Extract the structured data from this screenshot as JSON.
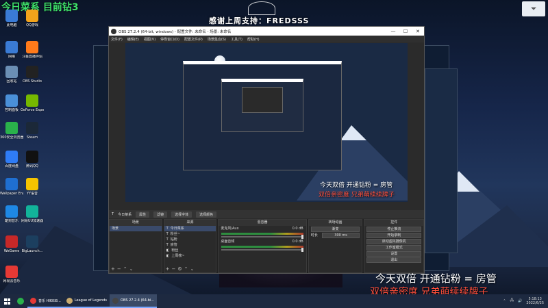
{
  "overlay_title": "今日菜系  目前钻3",
  "banner": "感谢上周支持：FREDSSS",
  "badge": "",
  "desktop_icons": [
    {
      "label": "此电脑",
      "icon": "computer-icon",
      "color": "#3a7bd5"
    },
    {
      "label": "QQ游戏",
      "icon": "qq-game-icon",
      "color": "#f2a31b"
    },
    {
      "label": "网络",
      "icon": "network-icon",
      "color": "#3a7bd5"
    },
    {
      "label": "斗鱼直播伴侣",
      "icon": "douyu-icon",
      "color": "#ff7a1a"
    },
    {
      "label": "回收站",
      "icon": "recycle-bin-icon",
      "color": "#6b8fb5"
    },
    {
      "label": "OBS Studio",
      "icon": "obs-icon",
      "color": "#222222"
    },
    {
      "label": "控制面板",
      "icon": "control-panel-icon",
      "color": "#4a90d9"
    },
    {
      "label": "GeForce Experience",
      "icon": "geforce-icon",
      "color": "#76b900"
    },
    {
      "label": "360安全浏览器",
      "icon": "360-browser-icon",
      "color": "#2ab24b"
    },
    {
      "label": "Steam",
      "icon": "steam-icon",
      "color": "#1b2838"
    },
    {
      "label": "百度网盘",
      "icon": "baidu-netdisk-icon",
      "color": "#2f7cf6"
    },
    {
      "label": "腾讯QQ",
      "icon": "qq-icon",
      "color": "#111111"
    },
    {
      "label": "Wallpaper Engine: ...",
      "icon": "wallpaper-engine-icon",
      "color": "#1f6fd1"
    },
    {
      "label": "YY语音",
      "icon": "yy-icon",
      "color": "#f5c400"
    },
    {
      "label": "酷狗音乐",
      "icon": "kugou-icon",
      "color": "#1e88e5"
    },
    {
      "label": "网易UU加速器",
      "icon": "uu-icon",
      "color": "#12b39a"
    },
    {
      "label": "WeGame",
      "icon": "wegame-icon",
      "color": "#c62828"
    },
    {
      "label": "BigLaunch...",
      "icon": "league-icon",
      "color": "#1c3f5f"
    },
    {
      "label": "网易云音乐",
      "icon": "netease-music-icon",
      "color": "#e53935"
    }
  ],
  "obs": {
    "title": "OBS 27.2.4 (64-bit, windows) - 配置文件: 未命名 - 场景: 未命名",
    "menu": [
      "文件(F)",
      "编辑(E)",
      "视图(V)",
      "停靠窗口(D)",
      "配置文件(P)",
      "场景集合(S)",
      "工具(T)",
      "帮助(H)"
    ],
    "context": {
      "source": "今日菜系",
      "props": "属性",
      "filters": "滤镜",
      "select1": "选择字体",
      "select2": "选择颜色"
    },
    "docks": {
      "scenes": {
        "header": "场景",
        "items": [
          "场景"
        ]
      },
      "sources": {
        "header": "来源",
        "items": [
          "今日菜系",
          "粉丝~",
          "钻粉",
          "房管",
          "粉丝",
          "上周榜~"
        ]
      },
      "mixer": {
        "header": "混音器",
        "channels": [
          {
            "name": "麦克风/Aux",
            "db": "0.0 dB"
          },
          {
            "name": "桌面音频",
            "db": "0.0 dB"
          }
        ]
      },
      "transitions": {
        "header": "转场动画",
        "type": "渐变",
        "duration_label": "时长",
        "duration": "300 ms"
      },
      "controls": {
        "header": "控件",
        "buttons": [
          "停止推流",
          "开始录制",
          "启动虚拟摄像机",
          "工作室模式",
          "设置",
          "退出"
        ]
      }
    }
  },
  "stream_text": {
    "line1": "今天双倍  开通钻粉 = 房管",
    "line2": "双倍亲密度   兄弟萌续续牌子"
  },
  "taskbar": {
    "items": [
      {
        "label": "音乐 HIKKI8...",
        "color": "#e53935"
      },
      {
        "label": "League of Legends",
        "color": "#c8aa6e"
      },
      {
        "label": "OBS 27.2.4 (64-bi...",
        "color": "#444444"
      }
    ],
    "time": "5:18:13",
    "date": "2022/6/25"
  }
}
